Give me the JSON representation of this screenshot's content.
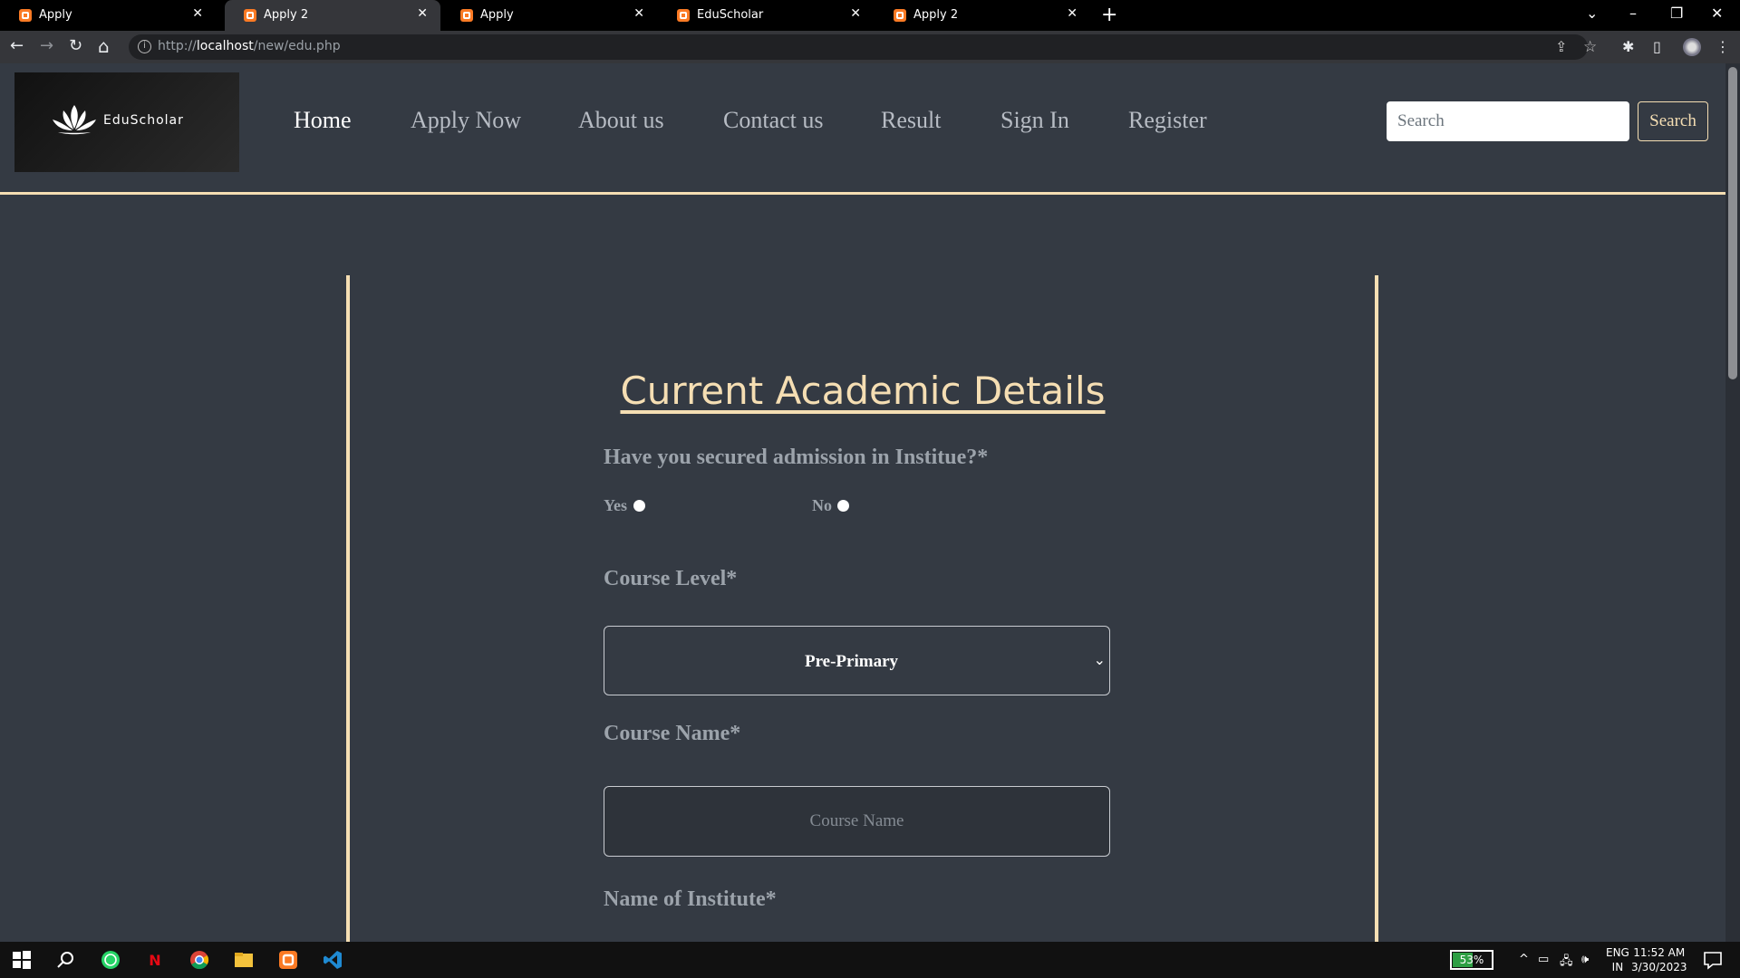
{
  "browser": {
    "tabs": [
      {
        "title": "Apply",
        "close": "✕"
      },
      {
        "title": "Apply 2",
        "close": "✕"
      },
      {
        "title": "Apply",
        "close": "✕"
      },
      {
        "title": "EduScholar",
        "close": "✕"
      },
      {
        "title": "Apply 2",
        "close": "✕"
      }
    ],
    "active_tab": 1,
    "new_tab": "+",
    "window_controls": {
      "tab_search": "⌄",
      "minimize": "–",
      "restore": "❐",
      "close": "✕"
    },
    "url_prefix": "http://",
    "url_host": "localhost",
    "url_path": "/new/edu.php",
    "nav_icons": {
      "back": "←",
      "forward": "→",
      "reload": "↻",
      "home": "⌂",
      "info": "i",
      "share": "⇪",
      "bookmark": "☆",
      "extensions": "✱",
      "sidepanel": "▯",
      "menu": "⋮"
    }
  },
  "site": {
    "logo_text": "EduScholar",
    "nav": [
      {
        "label": "Home"
      },
      {
        "label": "Apply Now"
      },
      {
        "label": "About us"
      },
      {
        "label": "Contact us"
      },
      {
        "label": "Result"
      },
      {
        "label": "Sign In"
      },
      {
        "label": "Register"
      }
    ],
    "active_nav": 0,
    "search": {
      "placeholder": "Search",
      "button": "Search"
    },
    "accent": "#f5deb3",
    "background": "#343a43"
  },
  "form": {
    "title": "Current Academic Details",
    "admission_question": "Have you secured admission in Institue?*",
    "radio_yes": "Yes",
    "radio_no": "No",
    "course_level_label": "Course Level*",
    "course_level_value": "Pre-Primary",
    "course_name_label": "Course Name*",
    "course_name_placeholder": "Course Name",
    "institute_label": "Name of Institute*"
  },
  "taskbar": {
    "apps": [
      "windows-start",
      "search",
      "whatsapp",
      "netflix",
      "chrome",
      "file-explorer",
      "xampp",
      "vscode"
    ],
    "battery_percent": 53,
    "battery_label": "53%",
    "language": "ENG",
    "region": "IN",
    "time": "11:52 AM",
    "date": "3/30/2023",
    "tray_chevron": "^"
  }
}
